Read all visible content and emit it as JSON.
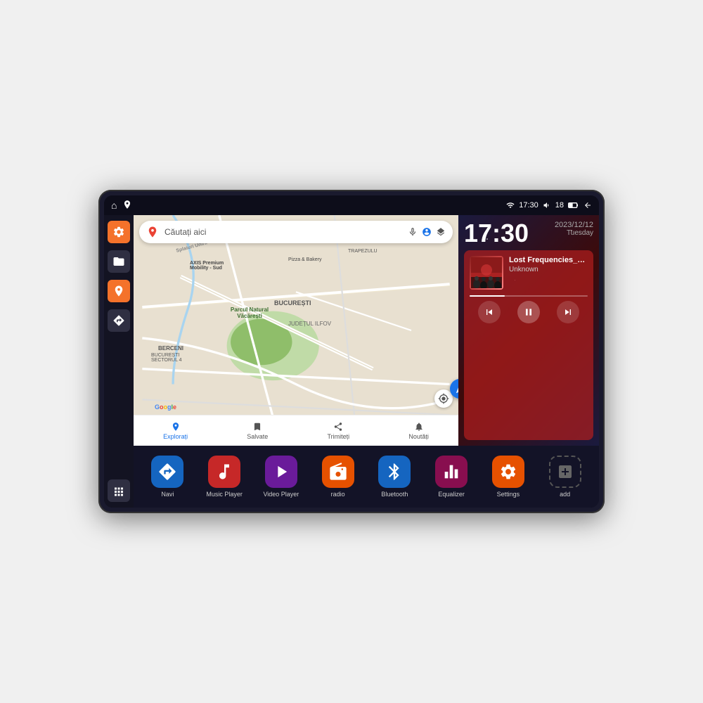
{
  "device": {
    "status_bar": {
      "wifi_icon": "wifi",
      "time": "17:30",
      "volume_icon": "volume",
      "battery_level": "18",
      "battery_icon": "battery",
      "back_icon": "back",
      "home_icon": "home",
      "maps_icon": "maps"
    },
    "clock": {
      "time": "17:30",
      "date": "2023/12/12",
      "weekday": "Tuesday"
    },
    "map": {
      "search_placeholder": "Căutați aici",
      "bottom_items": [
        {
          "label": "Explorați",
          "icon": "explore"
        },
        {
          "label": "Salvate",
          "icon": "bookmark"
        },
        {
          "label": "Trimiteți",
          "icon": "share"
        },
        {
          "label": "Noutăți",
          "icon": "bell"
        }
      ],
      "markers": [
        {
          "label": "AXIS Premium\nMobility - Sud"
        },
        {
          "label": "Pizza & Bakery"
        },
        {
          "label": "Parcul Natural Văcărești"
        },
        {
          "label": "BUCUREȘTI\nSECTORUL 4"
        },
        {
          "label": "BUCUREȘTI"
        },
        {
          "label": "JUDEȚUL ILFOV"
        },
        {
          "label": "BERCENI"
        },
        {
          "label": "Splaiuri Unirii"
        },
        {
          "label": "TRAPEZUL"
        }
      ]
    },
    "music": {
      "title": "Lost Frequencies_Janie...",
      "artist": "Unknown",
      "progress": 30,
      "controls": {
        "prev": "⏮",
        "play_pause": "⏸",
        "next": "⏭"
      }
    },
    "apps": [
      {
        "id": "navi",
        "label": "Navi",
        "icon_class": "navi",
        "icon": "▲"
      },
      {
        "id": "music-player",
        "label": "Music Player",
        "icon_class": "music",
        "icon": "♫"
      },
      {
        "id": "video-player",
        "label": "Video Player",
        "icon_class": "video",
        "icon": "▶"
      },
      {
        "id": "radio",
        "label": "radio",
        "icon_class": "radio",
        "icon": "📻"
      },
      {
        "id": "bluetooth",
        "label": "Bluetooth",
        "icon_class": "bluetooth",
        "icon": "⟨⟩"
      },
      {
        "id": "equalizer",
        "label": "Equalizer",
        "icon_class": "equalizer",
        "icon": "≡"
      },
      {
        "id": "settings",
        "label": "Settings",
        "icon_class": "settings",
        "icon": "⚙"
      },
      {
        "id": "add",
        "label": "add",
        "icon_class": "add",
        "icon": "+"
      }
    ],
    "sidebar": [
      {
        "id": "settings",
        "icon": "gear",
        "style": "orange"
      },
      {
        "id": "files",
        "icon": "folder",
        "style": "dark"
      },
      {
        "id": "maps",
        "icon": "map",
        "style": "orange"
      },
      {
        "id": "navigation",
        "icon": "navigate",
        "style": "dark"
      },
      {
        "id": "grid",
        "icon": "grid",
        "style": "dark"
      }
    ]
  }
}
